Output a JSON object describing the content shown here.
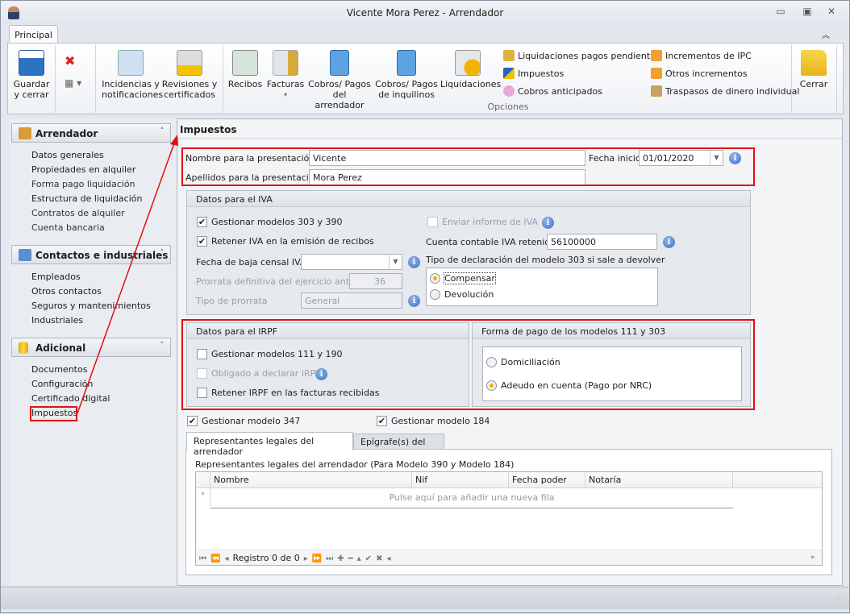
{
  "window": {
    "title": "Vicente Mora Perez - Arrendador",
    "minimize": "▭",
    "restore": "▣",
    "close": "✕"
  },
  "ribbon": {
    "tab": "Principal",
    "collapse": "︽",
    "group_label": "Opciones",
    "save_line1": "Guardar",
    "save_line2": "y cerrar",
    "delete_icon": "✖",
    "view_icon": "▦ ▾",
    "buttons": [
      {
        "l1": "Incidencias y",
        "l2": "notificaciones"
      },
      {
        "l1": "Revisiones y",
        "l2": "certificados"
      },
      {
        "l1": "Recibos",
        "l2": ""
      },
      {
        "l1": "Facturas",
        "l2": "▾"
      },
      {
        "l1": "Cobros/ Pagos",
        "l2": "del arrendador"
      },
      {
        "l1": "Cobros/ Pagos",
        "l2": "de inquilinos"
      },
      {
        "l1": "Liquidaciones",
        "l2": ""
      }
    ],
    "small": [
      "Liquidaciones pagos pendientes",
      "Impuestos",
      "Cobros anticipados",
      "Incrementos de IPC",
      "Otros incrementos",
      "Traspasos de dinero individual"
    ],
    "close": "Cerrar"
  },
  "sidebar": {
    "groups": [
      {
        "title": "Arrendador",
        "items": [
          "Datos generales",
          "Propiedades en alquiler",
          "Forma pago liquidación",
          "Estructura de liquidación",
          "Contratos de alquiler",
          "Cuenta bancaria"
        ]
      },
      {
        "title": "Contactos e industriales",
        "items": [
          "Empleados",
          "Otros contactos",
          "Seguros y mantenimientos",
          "Industriales"
        ]
      },
      {
        "title": "Adicional",
        "items": [
          "Documentos",
          "Configuración",
          "Certificado digital",
          "Impuestos"
        ]
      }
    ],
    "chevron": "˄"
  },
  "main": {
    "title": "Impuestos",
    "nombre_label": "Nombre para la presentación:",
    "nombre_value": "Vicente",
    "apellidos_label": "Apellidos para la presentación:",
    "apellidos_value": "Mora Perez",
    "fecha_inicio_label": "Fecha inicio:",
    "fecha_inicio_value": "01/01/2020",
    "info": "i",
    "iva": {
      "title": "Datos para el IVA",
      "gestionar": "Gestionar modelos 303 y 390",
      "retener": "Retener IVA en la emisión de recibos",
      "enviar": "Enviar informe de IVA",
      "cuenta_label": "Cuenta contable IVA retenido:",
      "cuenta_value": "56100000",
      "fecha_baja_label": "Fecha de baja censal IVA",
      "fecha_baja_value": "",
      "prorrata_label": "Prorrata definitiva del ejercicio anterior",
      "prorrata_value": "36",
      "tipo_prorrata_label": "Tipo de prorrata",
      "tipo_prorrata_value": "General",
      "tipo_decl_label": "Tipo de declaración del modelo 303 si sale a devolver",
      "compensar": "Compensar",
      "devolucion": "Devolución",
      "check": "✔"
    },
    "irpf": {
      "title": "Datos para el IRPF",
      "gestionar": "Gestionar modelos 111 y 190",
      "obligado": "Obligado a declarar IRPF",
      "retener": "Retener IRPF en las facturas recibidas"
    },
    "forma_pago": {
      "title": "Forma de pago de los modelos 111 y 303",
      "domiciliacion": "Domiciliación",
      "adeudo": "Adeudo en cuenta (Pago por NRC)"
    },
    "modelo347": "Gestionar modelo 347",
    "modelo184": "Gestionar modelo 184",
    "tabs": [
      "Representantes legales del arrendador",
      "Epígrafe(s) del I.A.E"
    ],
    "grid": {
      "caption": "Representantes legales del arrendador (Para Modelo 390 y Modelo 184)",
      "columns": [
        "Nombre",
        "Nif",
        "Fecha poder",
        "Notaría"
      ],
      "new_row": "Pulse aquí para añadir una nueva fila",
      "new_row_marker": "*",
      "record": "Registro 0 de 0"
    }
  },
  "colors": {
    "highlight": "#e01010",
    "accent": "#f2b300"
  }
}
